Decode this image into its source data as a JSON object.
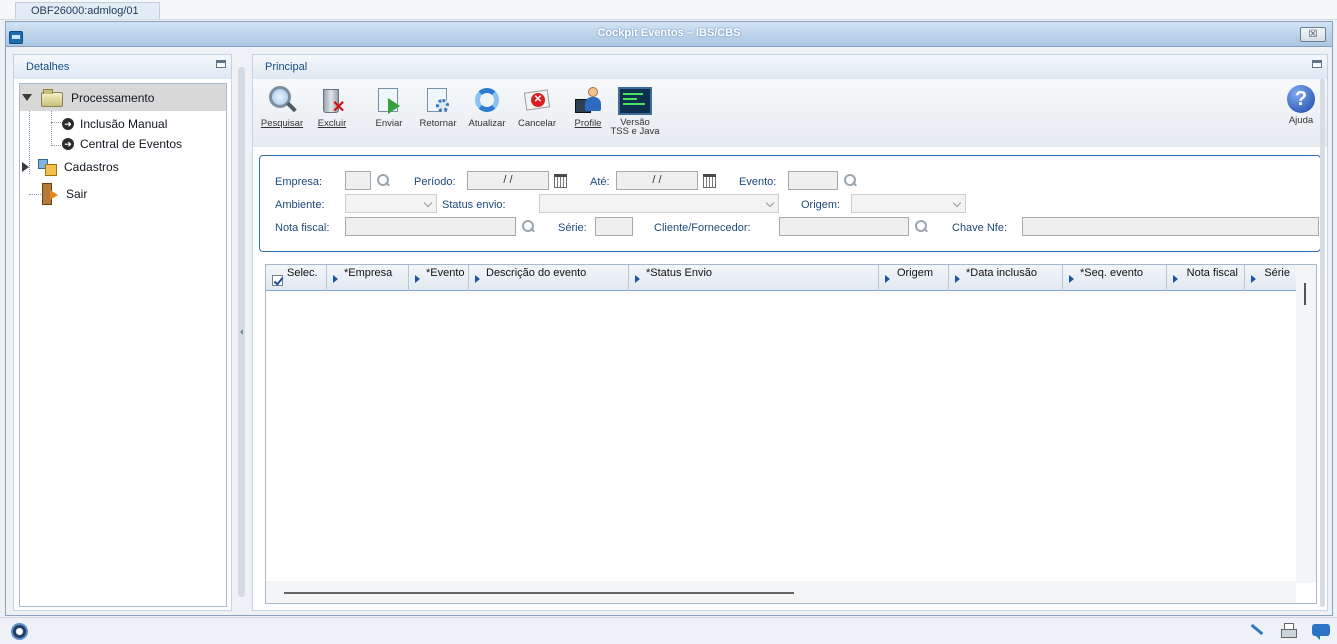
{
  "top_tab": {
    "label": "OBF26000:admlog/01"
  },
  "window": {
    "title": "Cockpit Eventos – IBS/CBS",
    "close_label": "☒"
  },
  "left_panel": {
    "title": "Detalhes",
    "tree": {
      "processamento": "Processamento",
      "inclusao_manual": "Inclusão Manual",
      "central_eventos": "Central de Eventos",
      "cadastros": "Cadastros",
      "sair": "Sair"
    }
  },
  "main_panel": {
    "title": "Principal",
    "toolbar": {
      "pesquisar": "Pesquisar",
      "excluir": "Excluir",
      "enviar": "Enviar",
      "retornar": "Retornar",
      "atualizar": "Atualizar",
      "cancelar": "Cancelar",
      "profile": "Profile",
      "versao_line1": "Versão",
      "versao_line2": "TSS e Java",
      "ajuda": "Ajuda"
    },
    "filters": {
      "empresa_label": "Empresa:",
      "periodo_label": "Período:",
      "periodo_value": " / /",
      "ate_label": "Até:",
      "ate_value": " / /",
      "evento_label": "Evento:",
      "ambiente_label": "Ambiente:",
      "status_envio_label": "Status envio:",
      "origem_label": "Origem:",
      "nota_fiscal_label": "Nota fiscal:",
      "serie_label": "Série:",
      "cliente_label": "Cliente/Fornecedor:",
      "chave_label": "Chave Nfe:"
    },
    "grid": {
      "columns": [
        "Selec.",
        "*Empresa",
        "*Evento",
        "Descrição do evento",
        "*Status Envio",
        "Origem",
        "*Data inclusão",
        "*Seq. evento",
        "Nota fiscal",
        "Série"
      ],
      "rows": []
    }
  },
  "colors": {
    "accent": "#3370b0",
    "title_gradient_top": "#d2e3f4",
    "title_gradient_bottom": "#aac6e4"
  }
}
